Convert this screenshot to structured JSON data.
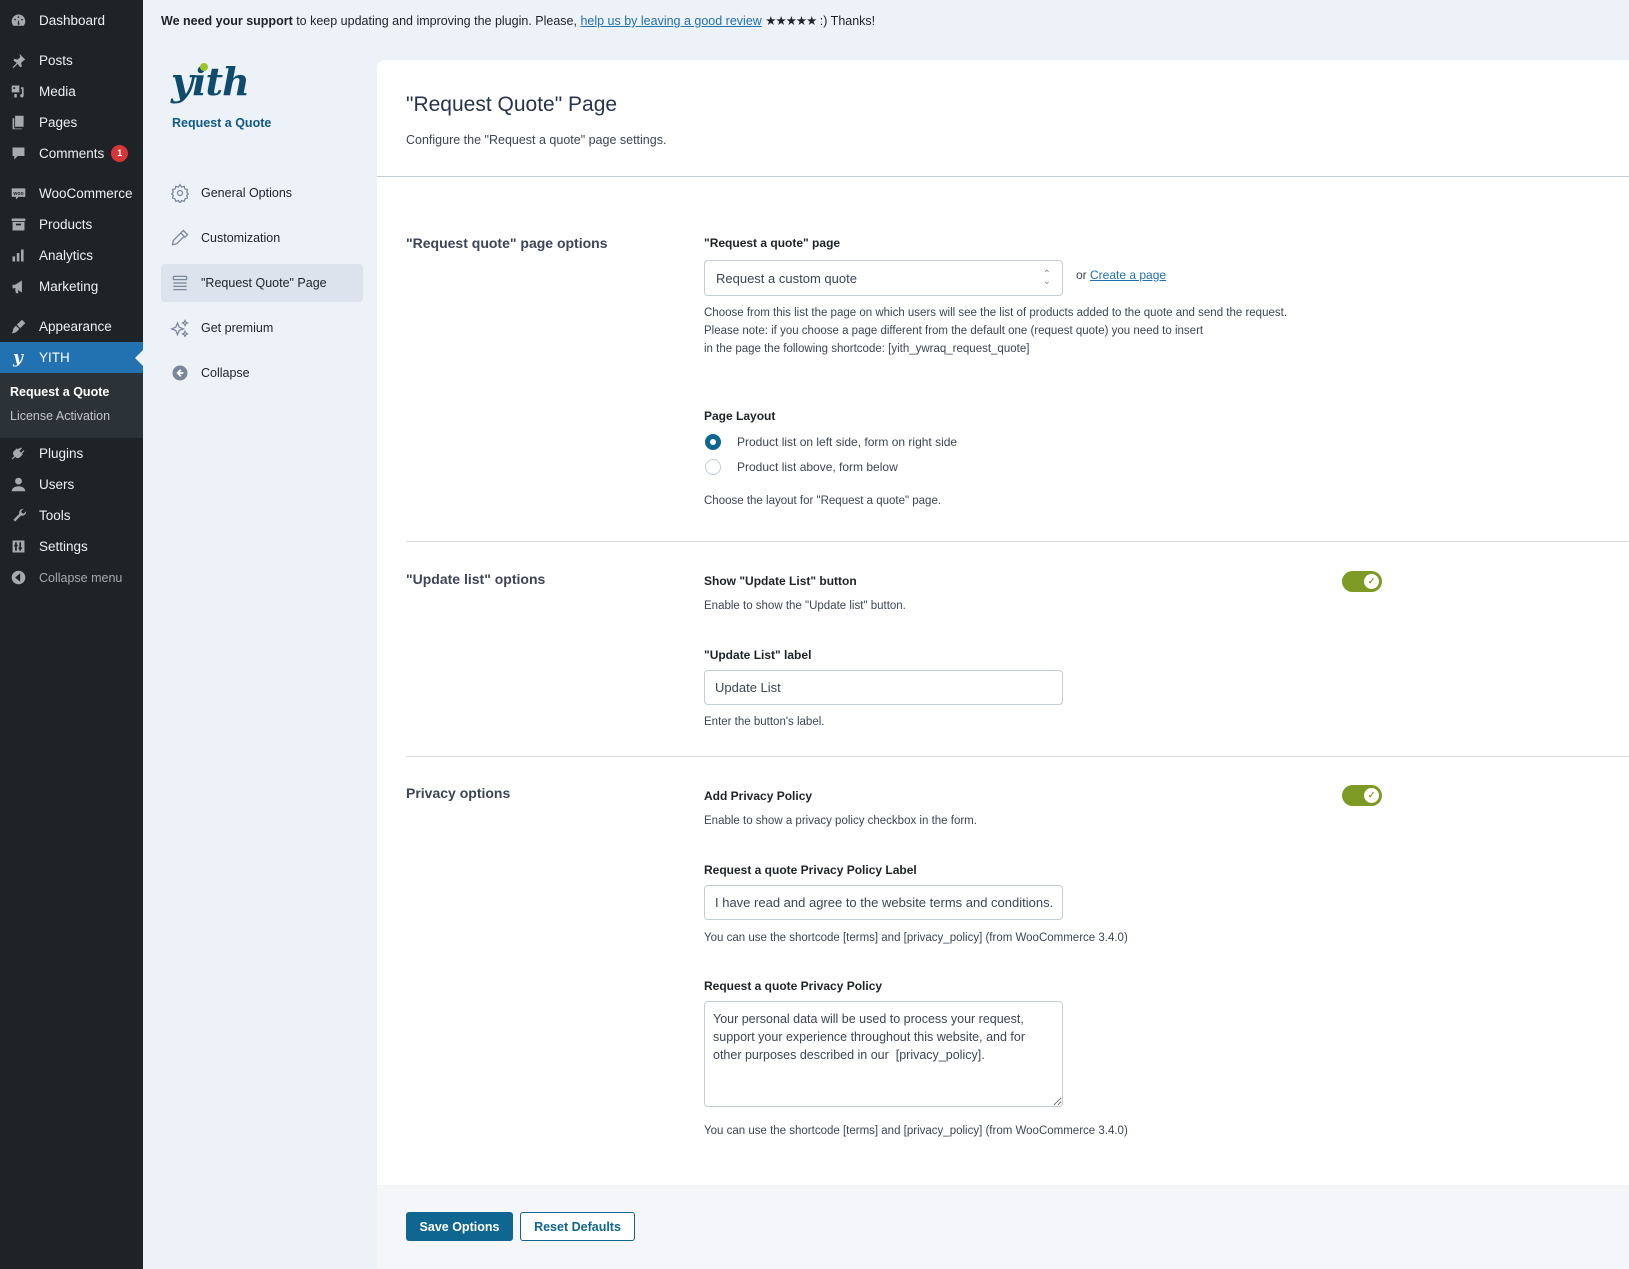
{
  "wp_menu": {
    "items": [
      {
        "label": "Dashboard",
        "icon": "dashboard-icon"
      },
      {
        "label": "Posts",
        "icon": "pin-icon"
      },
      {
        "label": "Media",
        "icon": "media-icon"
      },
      {
        "label": "Pages",
        "icon": "pages-icon"
      },
      {
        "label": "Comments",
        "icon": "comment-icon",
        "badge": "1"
      },
      {
        "label": "WooCommerce",
        "icon": "woo-icon"
      },
      {
        "label": "Products",
        "icon": "archive-icon"
      },
      {
        "label": "Analytics",
        "icon": "bar-chart-icon"
      },
      {
        "label": "Marketing",
        "icon": "megaphone-icon"
      },
      {
        "label": "Appearance",
        "icon": "brush-icon"
      },
      {
        "label": "YITH",
        "icon": "yith-icon"
      },
      {
        "label": "Plugins",
        "icon": "plug-icon"
      },
      {
        "label": "Users",
        "icon": "user-icon"
      },
      {
        "label": "Tools",
        "icon": "wrench-icon"
      },
      {
        "label": "Settings",
        "icon": "sliders-icon"
      },
      {
        "label": "Collapse menu",
        "icon": "collapse-arrow-icon"
      }
    ],
    "submenu": [
      "Request a Quote",
      "License Activation"
    ]
  },
  "notice": {
    "bold": "We need your support",
    "text": " to keep updating and improving the plugin. Please, ",
    "link": "help us by leaving a good review",
    "stars": "★★★★★",
    "end": " :) Thanks!"
  },
  "plugin_nav": {
    "logo_text": "yith",
    "plugin_name": "Request a Quote",
    "items": [
      {
        "label": "General Options",
        "icon": "gear-icon"
      },
      {
        "label": "Customization",
        "icon": "eyedropper-icon"
      },
      {
        "label": "\"Request Quote\" Page",
        "icon": "list-lines-icon",
        "active": true
      },
      {
        "label": "Get premium",
        "icon": "sparkles-icon"
      },
      {
        "label": "Collapse",
        "icon": "collapse-icon"
      }
    ]
  },
  "page": {
    "title": "\"Request Quote\" Page",
    "subtitle": "Configure the \"Request a quote\" page settings."
  },
  "sections": {
    "request_page": {
      "title": "\"Request quote\" page options",
      "page_label": "\"Request a quote\" page",
      "page_value": "Request a custom quote",
      "or_text": "or ",
      "create_link": "Create a page",
      "desc1": "Choose from this list the page on which users will see the list of products added to the quote and send the request.",
      "desc2": "Please note: if you choose a page different from the default one (request quote) you need to insert",
      "desc3": "in the page the following shortcode: [yith_ywraq_request_quote]",
      "layout_label": "Page Layout",
      "layout_options": [
        {
          "label": "Product list on left side, form on right side",
          "checked": true
        },
        {
          "label": "Product list above, form below",
          "checked": false
        }
      ],
      "layout_desc": "Choose the layout for \"Request a quote\" page."
    },
    "update_list": {
      "title": "\"Update list\" options",
      "show_label": "Show \"Update List\" button",
      "show_enabled": true,
      "show_desc": "Enable to show the \"Update list\" button.",
      "label_label": "\"Update List\" label",
      "label_value": "Update List",
      "label_desc": "Enter the button's label."
    },
    "privacy": {
      "title": "Privacy options",
      "add_label": "Add Privacy Policy",
      "add_enabled": true,
      "add_desc": "Enable to show a privacy policy checkbox in the form.",
      "pp_label_label": "Request a quote Privacy Policy Label",
      "pp_label_value": "I have read and agree to the website terms and conditions.",
      "pp_label_desc": "You can use the shortcode [terms] and [privacy_policy] (from WooCommerce 3.4.0)",
      "pp_text_label": "Request a quote Privacy Policy",
      "pp_text_value": "Your personal data will be used to process your request, support your experience throughout this website, and for other purposes described in our  [privacy_policy].",
      "pp_text_desc": "You can use the shortcode [terms] and [privacy_policy] (from WooCommerce 3.4.0)"
    }
  },
  "footer": {
    "save_label": "Save Options",
    "reset_label": "Reset Defaults"
  },
  "colors": {
    "accent": "#0f6690",
    "toggle_on": "#7c9a24",
    "wp_active": "#2271b1",
    "wp_sidebar": "#1d2327"
  }
}
